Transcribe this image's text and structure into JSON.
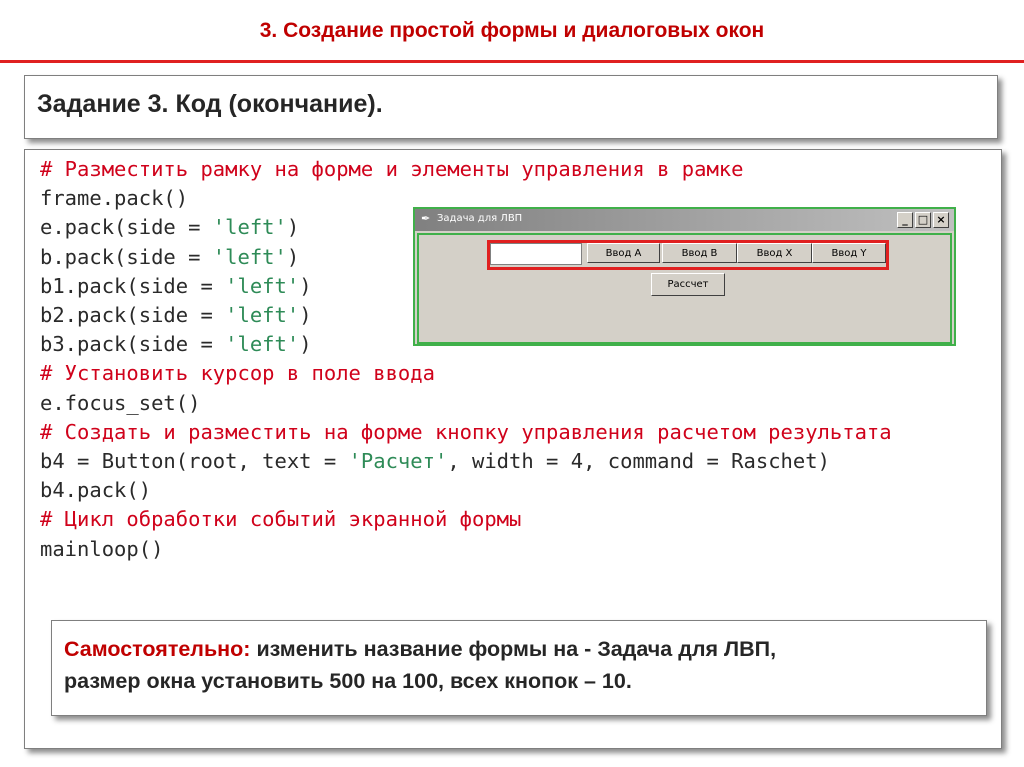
{
  "slide": {
    "title": "3. Создание простой формы и диалоговых окон",
    "task_title": "Задание 3. Код (окончание)."
  },
  "code": {
    "lines": [
      {
        "kind": "comment",
        "text": "# Разместить рамку на форме и элементы управления в рамке"
      },
      {
        "kind": "plain",
        "text": "frame.pack()"
      },
      {
        "kind": "call",
        "pre": "e.pack(side = ",
        "str": "'left'",
        "post": ")"
      },
      {
        "kind": "call",
        "pre": "b.pack(side = ",
        "str": "'left'",
        "post": ")"
      },
      {
        "kind": "call",
        "pre": "b1.pack(side = ",
        "str": "'left'",
        "post": ")"
      },
      {
        "kind": "call",
        "pre": "b2.pack(side = ",
        "str": "'left'",
        "post": ")"
      },
      {
        "kind": "call",
        "pre": "b3.pack(side = ",
        "str": "'left'",
        "post": ")"
      },
      {
        "kind": "comment",
        "text": "# Установить курсор в поле ввода"
      },
      {
        "kind": "plain",
        "text": "e.focus_set()"
      },
      {
        "kind": "comment",
        "text": "# Создать и разместить на форме кнопку управления расчетом результата"
      },
      {
        "kind": "call",
        "pre": "b4 = Button(root, text = ",
        "str": "'Расчет'",
        "post": ", width = 4, command = Raschet)"
      },
      {
        "kind": "plain",
        "text": "b4.pack()"
      },
      {
        "kind": "comment",
        "text": "# Цикл обработки событий экранной формы"
      },
      {
        "kind": "plain",
        "text": "mainloop()"
      }
    ]
  },
  "window": {
    "title": "Задача для ЛВП",
    "controls": {
      "minimize": "_",
      "maximize": "□",
      "close": "×"
    },
    "entry_value": "",
    "buttons": [
      "Ввод А",
      "Ввод В",
      "Ввод Х",
      "Ввод Y"
    ],
    "calc_button": "Рассчет"
  },
  "note": {
    "highlight": "Самостоятельно:",
    "line1": " изменить название формы на - Задача для ЛВП,",
    "line2": "размер окна установить 500 на 100,  всех кнопок – 10."
  },
  "colors": {
    "title": "#c00000",
    "comment": "#d0021b",
    "string": "#2e8b57",
    "frame_border": "#e02020",
    "window_border": "#40b04a"
  }
}
